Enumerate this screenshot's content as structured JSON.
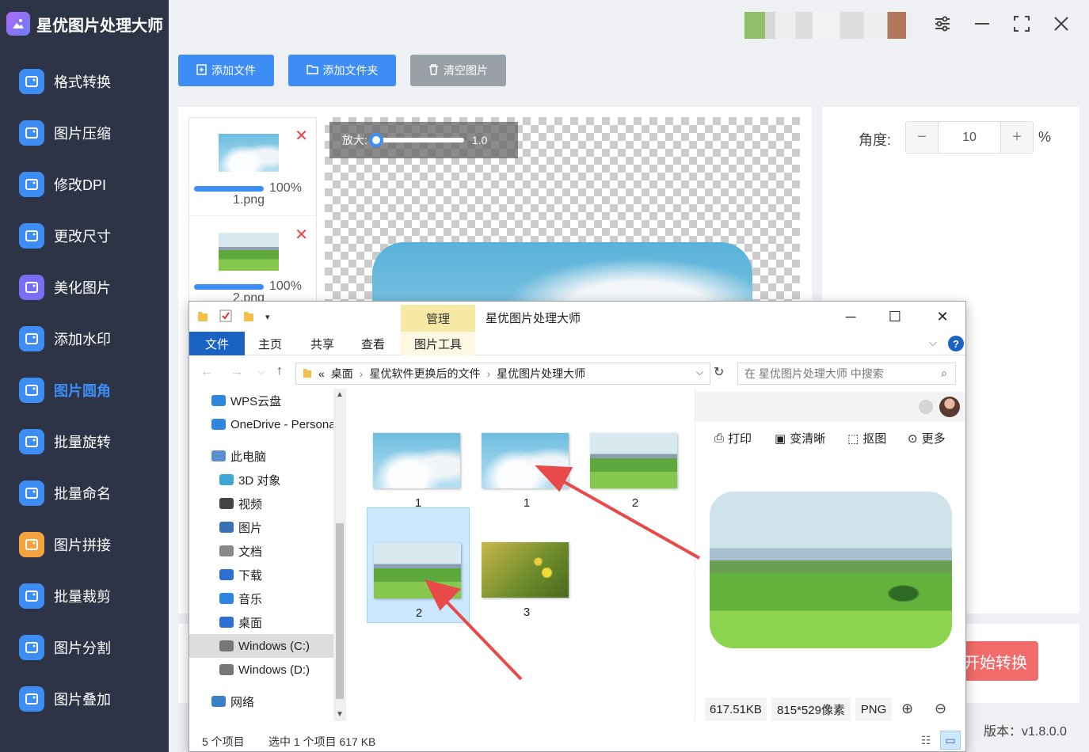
{
  "app": {
    "title": "星优图片处理大师",
    "version": "版本：v1.8.0.0"
  },
  "sidebar": {
    "items": [
      {
        "label": "格式转换",
        "icon": "image-convert-icon"
      },
      {
        "label": "图片压缩",
        "icon": "image-compress-icon"
      },
      {
        "label": "修改DPI",
        "icon": "dpi-icon"
      },
      {
        "label": "更改尺寸",
        "icon": "resize-icon"
      },
      {
        "label": "美化图片",
        "icon": "beautify-icon"
      },
      {
        "label": "添加水印",
        "icon": "watermark-icon"
      },
      {
        "label": "图片圆角",
        "icon": "rounded-corner-icon",
        "active": true
      },
      {
        "label": "批量旋转",
        "icon": "rotate-icon"
      },
      {
        "label": "批量命名",
        "icon": "rename-icon"
      },
      {
        "label": "图片拼接",
        "icon": "stitch-icon"
      },
      {
        "label": "批量裁剪",
        "icon": "crop-icon"
      },
      {
        "label": "图片分割",
        "icon": "split-icon"
      },
      {
        "label": "图片叠加",
        "icon": "layers-icon"
      }
    ]
  },
  "toolbar": {
    "add_file": "添加文件",
    "add_folder": "添加文件夹",
    "clear": "清空图片"
  },
  "thumbs": [
    {
      "pct": "100%",
      "name": "1.png",
      "progress": 1.0
    },
    {
      "pct": "100%",
      "name": "2.png",
      "progress": 1.0
    }
  ],
  "zoom": {
    "label": "放大:",
    "value": "1.0"
  },
  "settings": {
    "angle_label": "角度:",
    "angle_value": "10",
    "unit": "%",
    "minus": "−",
    "plus": "+"
  },
  "start_button": "开始转换",
  "explorer": {
    "title": "星优图片处理大师",
    "manage_tab": "管理",
    "tabs": [
      "文件",
      "主页",
      "共享",
      "查看",
      "图片工具"
    ],
    "path": [
      "«",
      "桌面",
      "星优软件更换后的文件",
      "星优图片处理大师"
    ],
    "search_placeholder": "在 星优图片处理大师 中搜索",
    "nav": [
      "WPS云盘",
      "OneDrive - Personal",
      "此电脑",
      "3D 对象",
      "视频",
      "图片",
      "文档",
      "下载",
      "音乐",
      "桌面",
      "Windows (C:)",
      "Windows (D:)",
      "网络"
    ],
    "files": [
      {
        "name": "1",
        "kind": "cloud"
      },
      {
        "name": "1",
        "kind": "cloud"
      },
      {
        "name": "2",
        "kind": "field"
      },
      {
        "name": "2",
        "kind": "field",
        "selected": true
      },
      {
        "name": "3",
        "kind": "flower"
      }
    ],
    "preview_actions": [
      "打印",
      "变清晰",
      "抠图",
      "更多"
    ],
    "preview_info": [
      "617.51KB",
      "815*529像素",
      "PNG"
    ],
    "status": {
      "count": "5 个项目",
      "selected": "选中 1 个项目  617 KB"
    }
  },
  "colors": {
    "accent": "#3d8df5",
    "sidebar": "#2d3446",
    "danger": "#f26b6b"
  }
}
